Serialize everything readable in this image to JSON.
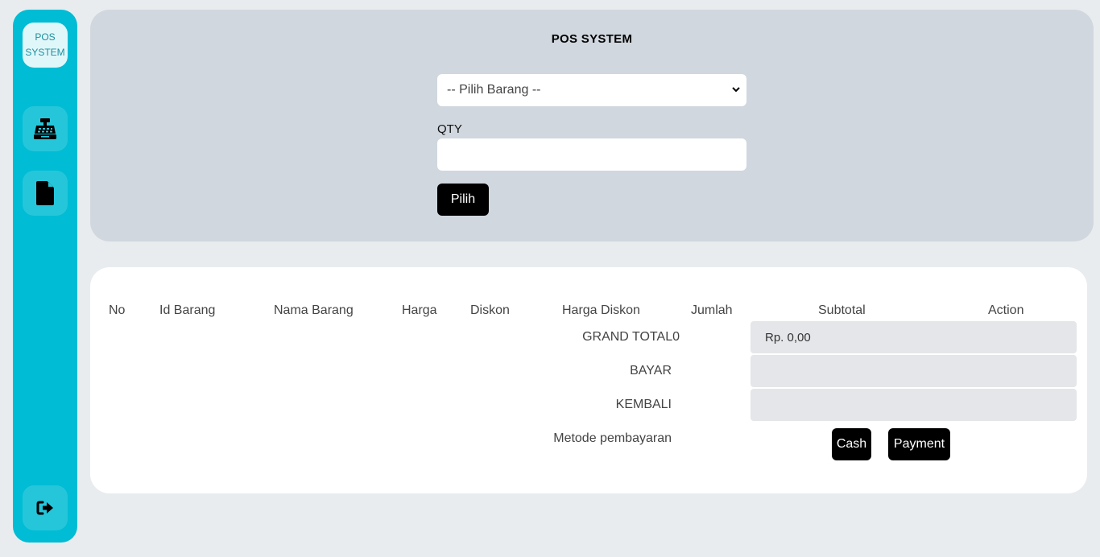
{
  "sidebar": {
    "brand_line1": "POS",
    "brand_line2": "SYSTEM",
    "items": [
      {
        "icon": "cash-register-icon"
      },
      {
        "icon": "file-icon"
      }
    ],
    "logout_icon": "sign-out-icon"
  },
  "form": {
    "title": "POS SYSTEM",
    "select_value": "-- Pilih Barang --",
    "qty_label": "QTY",
    "qty_value": "",
    "submit_label": "Pilih"
  },
  "table": {
    "columns": [
      "No",
      "Id Barang",
      "Nama Barang",
      "Harga",
      "Diskon",
      "Harga Diskon",
      "Jumlah",
      "Subtotal",
      "Action"
    ],
    "rows": []
  },
  "summary": {
    "grand_total_label": "GRAND TOTAL",
    "grand_total_count": "0",
    "grand_total_value": "Rp. 0,00",
    "bayar_label": "BAYAR",
    "bayar_value": "",
    "kembali_label": "KEMBALI",
    "kembali_value": "",
    "method_label": "Metode pembayaran",
    "cash_label": "Cash",
    "payment_label": "Payment"
  },
  "colors": {
    "sidebar": "#00bcd4",
    "background": "#e9ecef",
    "top_card": "#d0d7de",
    "button": "#000000"
  }
}
